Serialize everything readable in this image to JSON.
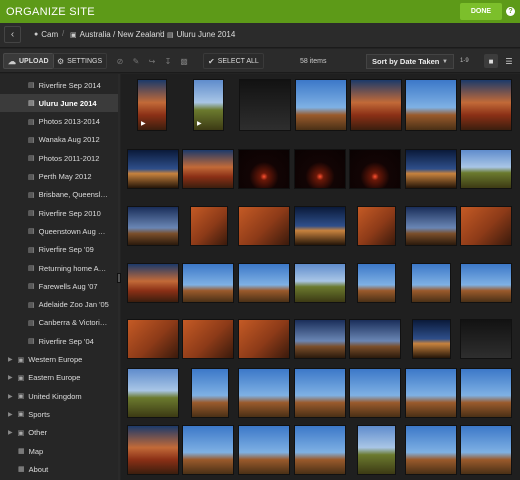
{
  "header": {
    "title": "ORGANIZE SITE",
    "done_label": "DONE",
    "help_icon": "?"
  },
  "breadcrumb": {
    "back_icon": "‹",
    "user": "Cam",
    "folder": "Australia / New Zealand",
    "album": "Uluru June 2014"
  },
  "toolbar": {
    "upload_label": "UPLOAD",
    "settings_label": "SETTINGS",
    "select_all_label": "SELECT ALL",
    "item_count": "58 items",
    "sort_value": "Sort by Date Taken",
    "range_label": "1-9"
  },
  "sidebar": {
    "albums": [
      {
        "label": "Riverfire Sep 2014",
        "active": false
      },
      {
        "label": "Uluru June 2014",
        "active": true
      },
      {
        "label": "Photos 2013-2014",
        "active": false
      },
      {
        "label": "Wanaka Aug 2012",
        "active": false
      },
      {
        "label": "Photos 2011-2012",
        "active": false
      },
      {
        "label": "Perth May 2012",
        "active": false
      },
      {
        "label": "Brisbane, Queensl…",
        "active": false
      },
      {
        "label": "Riverfire Sep 2010",
        "active": false
      },
      {
        "label": "Queenstown Aug …",
        "active": false
      },
      {
        "label": "Riverfire Sep '09",
        "active": false
      },
      {
        "label": "Returning home A…",
        "active": false
      },
      {
        "label": "Farewells Aug '07",
        "active": false
      },
      {
        "label": "Adelaide Zoo Jan '05",
        "active": false
      },
      {
        "label": "Canberra & Victori…",
        "active": false
      },
      {
        "label": "Riverfire Sep '04",
        "active": false
      }
    ],
    "groups": [
      "Western Europe",
      "Eastern Europe",
      "United Kingdom",
      "Sports",
      "Other"
    ],
    "pages": [
      "Map",
      "About"
    ]
  },
  "colors": {
    "accent": "#5d9a18",
    "done_button": "#7cbf2b"
  }
}
